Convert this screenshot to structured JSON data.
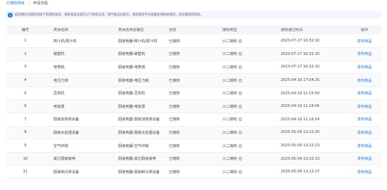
{
  "breadcrumb": {
    "link": "已授权类目",
    "separator": "›",
    "current": "申请流程"
  },
  "notice": {
    "icon": "info-icon",
    "text": "如您拥有已授权资质下的授权类目，系统将自动显示以下授权信息；如不能自动显示，请您联系平台客服处理相关授权，请注意授权时效。"
  },
  "table": {
    "columns": [
      "编号",
      "类目名称",
      "类目名称全路径",
      "状态",
      "授权类型",
      "授权通过时间",
      "操作"
    ],
    "rows": [
      {
        "id": "1",
        "name": "榨汁机/原汁机",
        "path": "厨房电器-榨汁机/原汁机",
        "status": "已授权",
        "type": "小二授权",
        "time": "2023-07-17 16:32:10",
        "op": "发布商品"
      },
      {
        "id": "2",
        "name": "破壁机",
        "path": "厨房电器-破壁机",
        "status": "已授权",
        "type": "小二授权",
        "time": "2023-07-17 16:32:10",
        "op": "发布商品"
      },
      {
        "id": "3",
        "name": "电煮锅",
        "path": "厨房电器-电煮锅",
        "status": "已授权",
        "type": "小二授权",
        "time": "2023-07-17 16:32:10",
        "op": "发布商品"
      },
      {
        "id": "4",
        "name": "电压力锅",
        "path": "厨房电器-电压力锅",
        "status": "已授权",
        "type": "小二授权",
        "time": "2025-04-19 17:04:25",
        "op": "发布商品"
      },
      {
        "id": "5",
        "name": "豆浆机",
        "path": "厨房电器-豆浆机",
        "status": "已授权",
        "type": "小二授权",
        "time": "2025-04-19 11:15:50",
        "op": "发布商品"
      },
      {
        "id": "6",
        "name": "电饭煲",
        "path": "厨房电器-电饭煲",
        "status": "已授权",
        "type": "小二授权",
        "time": "2025-04-19 11:16:05",
        "op": "发布商品"
      },
      {
        "id": "7",
        "name": "厨房加热类设备",
        "path": "厨房电器-厨房加热类设备",
        "status": "已授权",
        "type": "小二授权",
        "time": "2025-04-19 11:16:54",
        "op": "发布商品"
      },
      {
        "id": "8",
        "name": "厨房水处理设备",
        "path": "厨房电器-厨房水处理设备",
        "status": "已授权",
        "type": "小二授权",
        "time": "2025-05-09 13:22:20",
        "op": "发布商品"
      },
      {
        "id": "9",
        "name": "空气炸锅",
        "path": "厨房电器-空气炸锅",
        "status": "已授权",
        "type": "小二授权",
        "time": "2025-05-09 13:22:23",
        "op": "发布商品"
      },
      {
        "id": "10",
        "name": "其它厨房家电",
        "path": "厨房电器-其它厨房家电",
        "status": "已授权",
        "type": "小二授权",
        "time": "2025-05-09 13:22:13",
        "op": "发布商品"
      },
      {
        "id": "11",
        "name": "厨房制冷类设备",
        "path": "厨房电器-厨房制冷类设备",
        "status": "已授权",
        "type": "小二授权",
        "time": "2025-05-09 13:22:17",
        "op": "发布商品"
      }
    ]
  },
  "help_icon": "question-circle-icon",
  "colors": {
    "link": "#1677ff",
    "notice_bg": "#f0f5ff",
    "header_bg": "#f5f6f8"
  }
}
